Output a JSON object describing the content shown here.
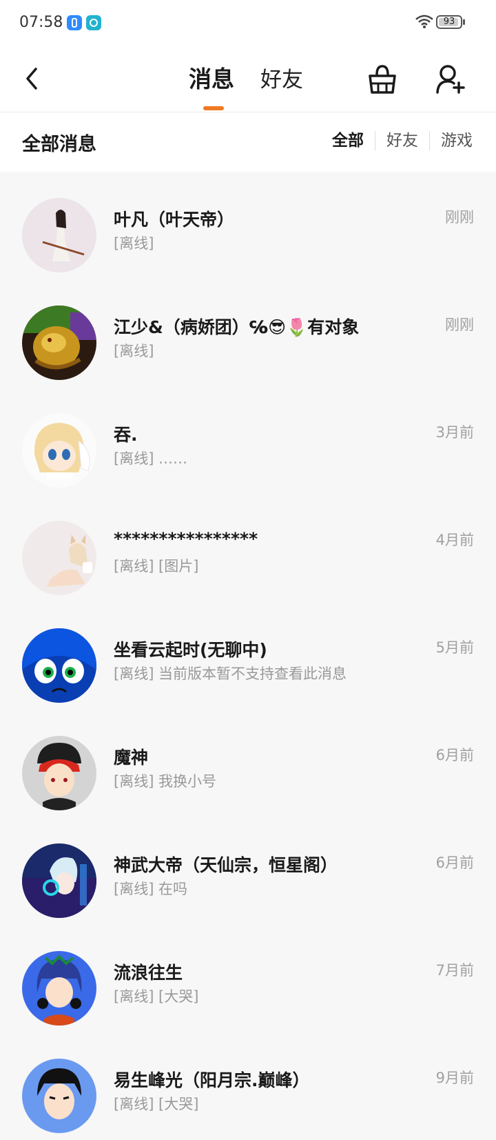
{
  "status_bar": {
    "time": "07:58",
    "battery": "93",
    "battery_level": 0.93
  },
  "header": {
    "tab_messages": "消息",
    "tab_friends": "好友"
  },
  "filter": {
    "title": "全部消息",
    "tabs": [
      "全部",
      "好友",
      "游戏"
    ]
  },
  "messages": [
    {
      "name": "叶凡（叶天帝）",
      "preview": "[离线]",
      "time": "刚刚"
    },
    {
      "name": "江少&（病娇团）℅😎🌷有对象",
      "preview": "[离线]",
      "time": "刚刚"
    },
    {
      "name": "吞.",
      "preview": "[离线] ……",
      "time": "3月前"
    },
    {
      "name": "****************",
      "preview": "[离线] [图片]",
      "time": "4月前"
    },
    {
      "name": "坐看云起时(无聊中)",
      "preview": "[离线] 当前版本暂不支持查看此消息",
      "time": "5月前"
    },
    {
      "name": "魔神",
      "preview": "[离线] 我换小号",
      "time": "6月前"
    },
    {
      "name": "神武大帝（天仙宗，恒星阁）",
      "preview": "[离线] 在吗",
      "time": "6月前"
    },
    {
      "name": "流浪往生",
      "preview": "[离线] [大哭]",
      "time": "7月前"
    },
    {
      "name": "易生峰光（阳月宗.巅峰）",
      "preview": "[离线] [大哭]",
      "time": "9月前"
    }
  ]
}
